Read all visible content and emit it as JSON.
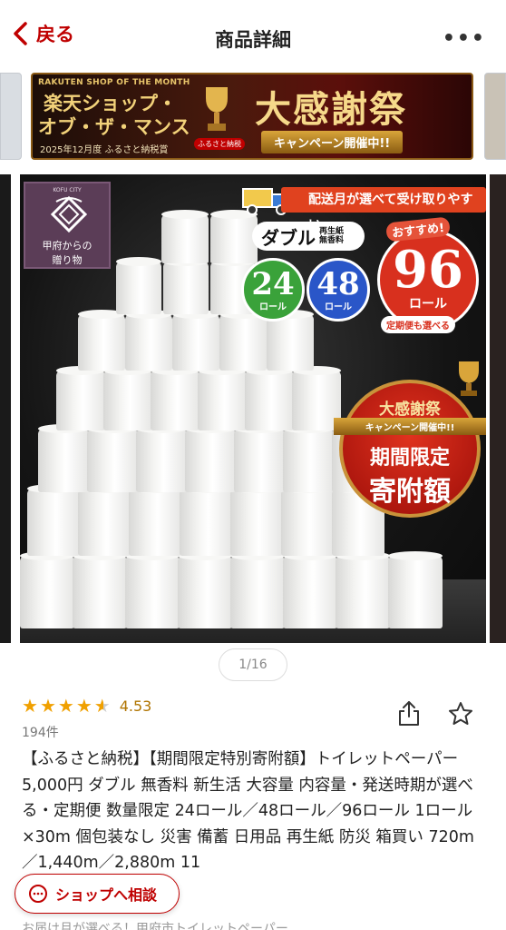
{
  "header": {
    "back_label": "戻る",
    "title": "商品詳細",
    "more_label": "•••"
  },
  "banner": {
    "top_text": "RAKUTEN SHOP OF THE MONTH",
    "line1": "楽天ショップ・",
    "line2": "オブ・ザ・マンス",
    "line3": "2025年12月度 ふるさと納税賞",
    "badge": "ふるさと納税",
    "big": "大感謝祭",
    "sub": "キャンペーン開催中!!"
  },
  "hero": {
    "logo_city": "KOFU CITY",
    "logo_line1": "甲府からの",
    "logo_line2": "贈り物",
    "delivery": "配送月が選べて受け取りやすい",
    "double_main": "ダブル",
    "double_sub1": "再生紙",
    "double_sub2": "無香料",
    "osusume": "おすすめ!",
    "c24_num": "24",
    "c24_unit": "ロール",
    "c48_num": "48",
    "c48_unit": "ロール",
    "c96_num": "96",
    "c96_unit": "ロール",
    "teiki": "定期便も選べる",
    "cmp1": "大感謝祭",
    "cmp2": "キャンペーン開催中!!",
    "cmp3": "期間限定",
    "cmp4": "寄附額"
  },
  "pager": "1/16",
  "rating": {
    "value": "4.53",
    "stars": 4.53,
    "count": "194件"
  },
  "product_title": "【ふるさと納税】【期間限定特別寄附額】トイレットペーパー 5,000円 ダブル 無香料 新生活 大容量 内容量・発送時期が選べる・定期便 数量限定 24ロール／48ロール／96ロール 1ロール×30m 個包装なし 災害 備蓄 日用品 再生紙 防災 箱買い 720m／1,440m／2,880m 11",
  "next_line": "お届け月が選べる！甲府市トイレットペーパー",
  "consult_label": "ショップへ相談",
  "colors": {
    "accent": "#bf0000",
    "star": "#f0a000"
  }
}
